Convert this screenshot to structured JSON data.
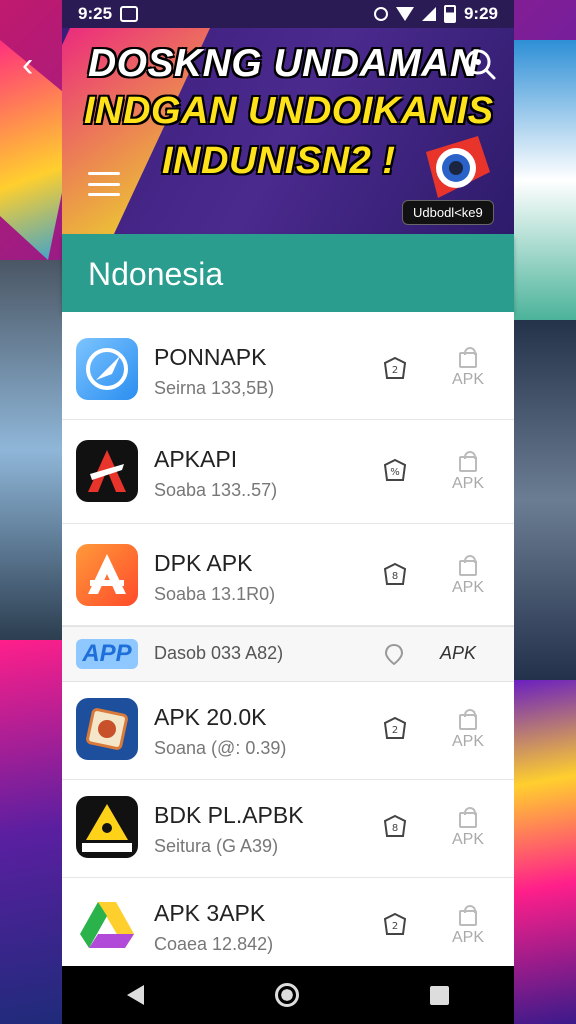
{
  "status_bar": {
    "time_left": "9:25",
    "time_right": "9:29"
  },
  "header": {
    "line1": "DOSKNG UNDAMAN",
    "line2": "INDGAN UNDOIKANIS",
    "line3": "INDUNISN2 !",
    "brand_tag": "Udbodl<ke9"
  },
  "section": {
    "title": "Ndonesia"
  },
  "apps": [
    {
      "name": "PONNAPK",
      "meta": "Seirna 133,5B)",
      "apk": "APK",
      "icon": "compass-icon",
      "colors": [
        "#2b8ef0",
        "#7cc4ff"
      ]
    },
    {
      "name": "APKAPI",
      "meta": "Soaba 133..57)",
      "apk": "APK",
      "icon": "red-a-icon",
      "colors": [
        "#111111",
        "#e8342a"
      ]
    },
    {
      "name": "DPK APK",
      "meta": "Soaba 13.1R0)",
      "apk": "APK",
      "icon": "orange-a-icon",
      "colors": [
        "#ff5a2a",
        "#ff9a3a"
      ]
    },
    {
      "name": "APK 20.0K",
      "meta": "Soana (@: 0.39)",
      "apk": "APK",
      "icon": "badge-icon",
      "colors": [
        "#1e4f9c",
        "#d97a3a"
      ]
    },
    {
      "name": "BDK PL.APBK",
      "meta": "Seitura (G A39)",
      "apk": "APK",
      "icon": "yellow-triangle-icon",
      "colors": [
        "#111111",
        "#ffd21a"
      ]
    },
    {
      "name": "APK 3APK",
      "meta": "Coaea 12.842)",
      "apk": "APK",
      "icon": "drive-icon",
      "colors": [
        "#ffffff",
        "#2ab34a"
      ]
    }
  ],
  "compact": {
    "logo_text": "APP",
    "text": "Dasob 033 A82)",
    "apk": "APK"
  }
}
